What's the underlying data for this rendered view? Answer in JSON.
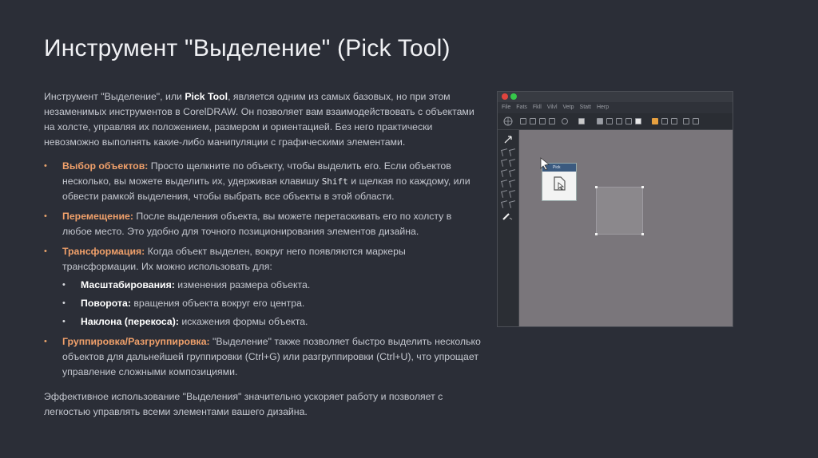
{
  "title": "Инструмент \"Выделение\" (Pick Tool)",
  "intro": {
    "pre": "Инструмент \"Выделение\", или ",
    "bold": "Pick Tool",
    "post": ", является одним из самых базовых, но при этом незаменимых инструментов в CorelDRAW. Он позволяет вам взаимодействовать с объектами на холсте, управляя их положением, размером и ориентацией. Без него практически невозможно выполнять какие-либо манипуляции с графическими элементами."
  },
  "bullets": [
    {
      "label": "Выбор объектов:",
      "text_a": " Просто щелкните по объекту, чтобы выделить его. Если объектов несколько, вы можете выделить их, удерживая клавишу ",
      "key": "Shift",
      "text_b": " и щелкая по каждому, или обвести рамкой выделения, чтобы выбрать все объекты в этой области."
    },
    {
      "label": "Перемещение:",
      "text": " После выделения объекта, вы можете перетаскивать его по холсту в любое место. Это удобно для точного позиционирования элементов дизайна."
    },
    {
      "label": "Трансформация:",
      "text": " Когда объект выделен, вокруг него появляются маркеры трансформации. Их можно использовать для:",
      "sub": [
        {
          "label": "Масштабирования:",
          "text": " изменения размера объекта."
        },
        {
          "label": "Поворота:",
          "text": " вращения объекта вокруг его центра."
        },
        {
          "label": "Наклона (перекоса):",
          "text": " искажения формы объекта."
        }
      ]
    },
    {
      "label": "Группировка/Разгруппировка:",
      "text": " \"Выделение\" также позволяет быстро выделить несколько объектов для дальнейшей группировки (Ctrl+G) или разгруппировки (Ctrl+U), что упрощает управление сложными композициями."
    }
  ],
  "outro": "Эффективное использование \"Выделения\" значительно ускоряет работу и позволяет с легкостью управлять всеми элементами вашего дизайна.",
  "app": {
    "menu": [
      "File",
      "Fats",
      "Fkll",
      "Vilvl",
      "Vetp",
      "Statt",
      "Herp"
    ],
    "popup_label": "Pick",
    "colors": {
      "canvas": "#7a767b",
      "accent": "#f0a06a",
      "popup_header": "#3b5a7f"
    }
  }
}
